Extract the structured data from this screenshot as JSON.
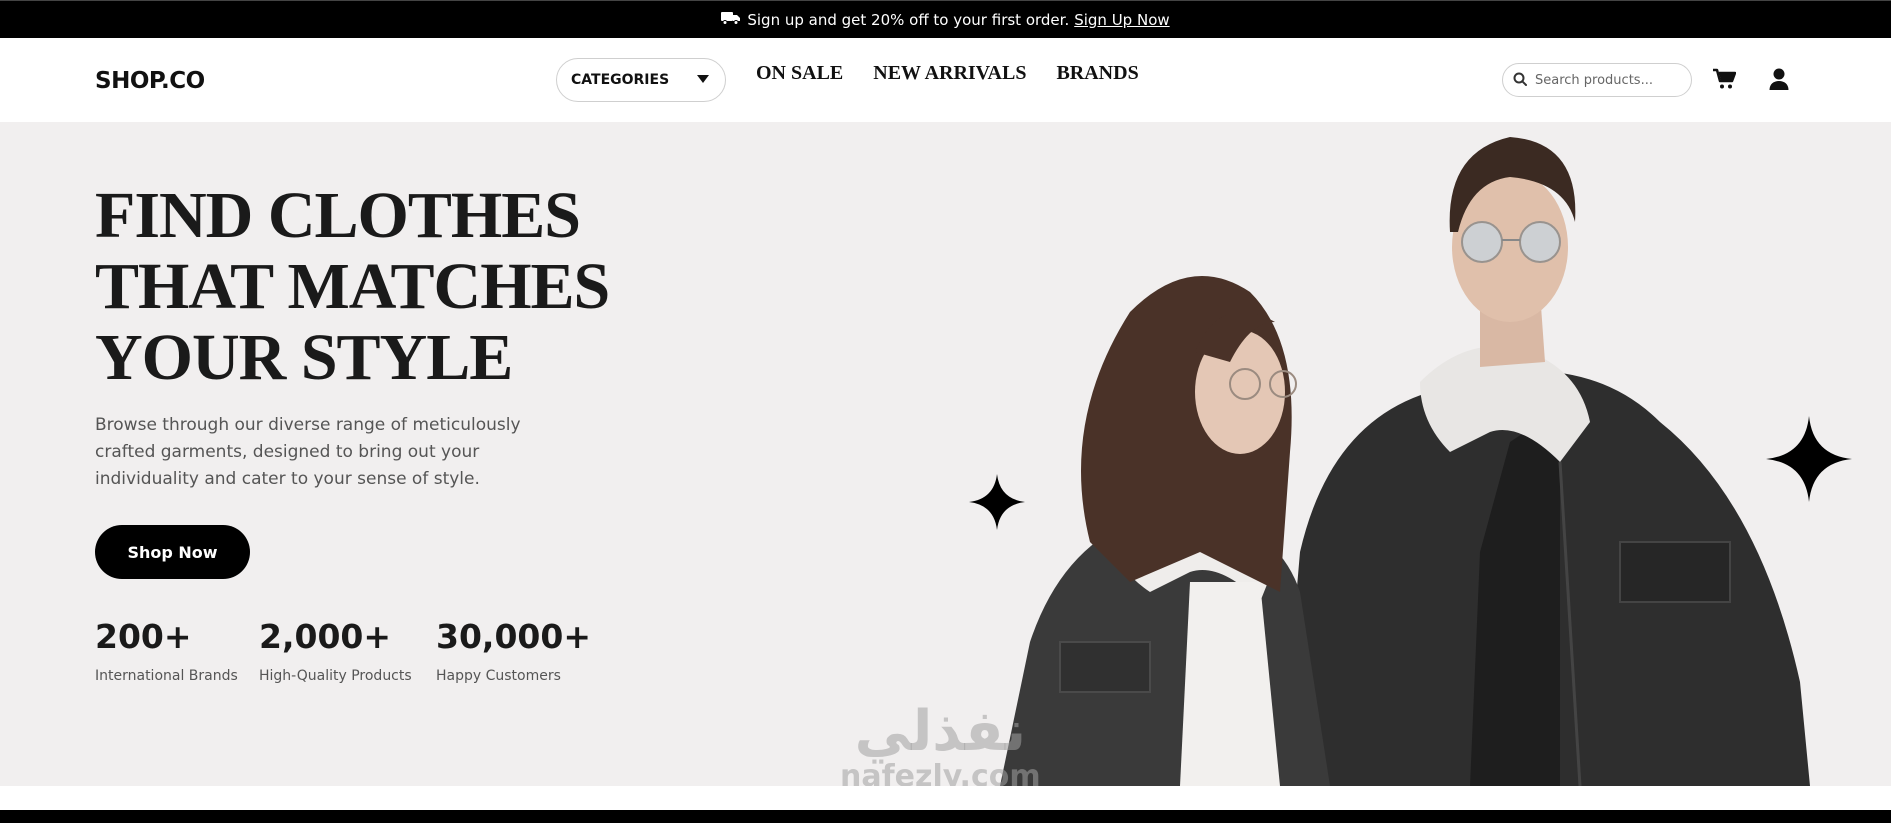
{
  "announcement": {
    "text": "Sign up and get 20% off to your first order.",
    "link": "Sign Up Now",
    "icon": "truck-icon"
  },
  "header": {
    "logo": "SHOP.CO",
    "categories_label": "CATEGORIES",
    "nav": [
      "ON SALE",
      "NEW ARRIVALS",
      "BRANDS"
    ],
    "search_placeholder": "Search products...",
    "icons": [
      "search-icon",
      "cart-icon",
      "user-icon"
    ]
  },
  "hero": {
    "title_lines": [
      "FIND CLOTHES",
      "THAT MATCHES",
      "YOUR STYLE"
    ],
    "description": "Browse through our diverse range of meticulously crafted garments, designed to bring out your individuality and cater to your sense of style.",
    "cta": "Shop Now",
    "stats": [
      {
        "number": "200+",
        "label": "International Brands"
      },
      {
        "number": "2,000+",
        "label": "High-Quality Products"
      },
      {
        "number": "30,000+",
        "label": "Happy Customers"
      }
    ]
  },
  "watermark": {
    "arabic": "نفذلي",
    "latin": "nafezly.com"
  },
  "colors": {
    "background": "#f1efef",
    "accent": "#000000",
    "text": "#1a1a1a"
  }
}
